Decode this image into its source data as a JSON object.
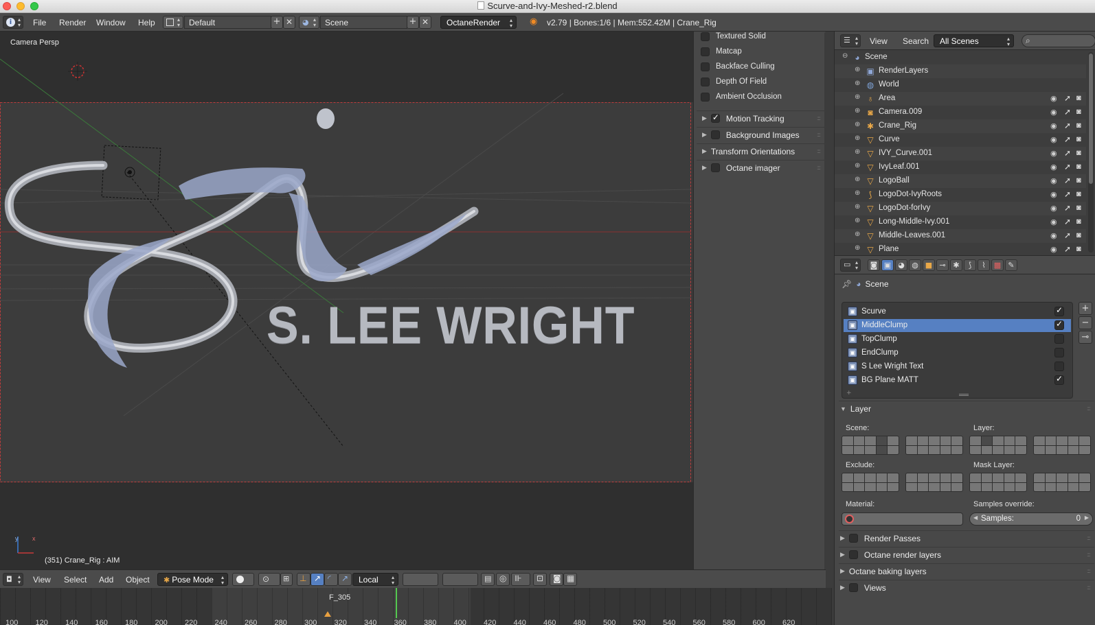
{
  "window": {
    "title": "Scurve-and-Ivy-Meshed-r2.blend"
  },
  "info_header": {
    "menus": [
      "File",
      "Render",
      "Window",
      "Help"
    ],
    "screen_layout": "Default",
    "scene": "Scene",
    "render_engine": "OctaneRender",
    "stats": "v2.79 | Bones:1/6 | Mem:552.42M | Crane_Rig"
  },
  "viewport": {
    "view_label": "Camera Persp",
    "status": "(351) Crane_Rig : AIM",
    "logo_text": "S. LEE WRIGHT",
    "axis_x": "x",
    "axis_y": "y"
  },
  "npanel": {
    "options": [
      {
        "label": "Textured Solid",
        "checked": false
      },
      {
        "label": "Matcap",
        "checked": false
      },
      {
        "label": "Backface Culling",
        "checked": false
      },
      {
        "label": "Depth Of Field",
        "checked": false
      },
      {
        "label": "Ambient Occlusion",
        "checked": false
      }
    ],
    "subpanels": [
      {
        "label": "Motion Tracking",
        "checked": true
      },
      {
        "label": "Background Images",
        "checked": false
      },
      {
        "label": "Transform Orientations",
        "checked": null
      },
      {
        "label": "Octane imager",
        "checked": false
      }
    ]
  },
  "vp_header": {
    "menus": [
      "View",
      "Select",
      "Add",
      "Object"
    ],
    "mode": "Pose Mode",
    "orientation": "Local"
  },
  "timeline": {
    "frame_marker": "F_305",
    "ticks": [
      "100",
      "120",
      "140",
      "160",
      "180",
      "200",
      "220",
      "240",
      "260",
      "280",
      "300",
      "320",
      "340",
      "360",
      "380",
      "400",
      "420",
      "440",
      "460",
      "480",
      "500",
      "520",
      "540",
      "560",
      "580",
      "600",
      "620"
    ]
  },
  "outliner": {
    "menus": [
      "View",
      "Search"
    ],
    "filter": "All Scenes",
    "root": "Scene",
    "items": [
      {
        "name": "RenderLayers",
        "icon": "render-layers-icon",
        "glyph": "▣",
        "color": "#8fa7d6",
        "visible": false
      },
      {
        "name": "World",
        "icon": "world-icon",
        "glyph": "◍",
        "color": "#7fa4d9",
        "visible": false
      },
      {
        "name": "Area",
        "icon": "lamp-icon",
        "glyph": "♁",
        "color": "#e9a848",
        "visible": true
      },
      {
        "name": "Camera.009",
        "icon": "camera-icon",
        "glyph": "◙",
        "color": "#e9a848",
        "visible": true
      },
      {
        "name": "Crane_Rig",
        "icon": "armature-icon",
        "glyph": "✱",
        "color": "#e9a848",
        "visible": true
      },
      {
        "name": "Curve",
        "icon": "curve-icon",
        "glyph": "▽",
        "color": "#e9a848",
        "visible": true
      },
      {
        "name": "IVY_Curve.001",
        "icon": "mesh-icon",
        "glyph": "▽",
        "color": "#e9a848",
        "visible": true
      },
      {
        "name": "IvyLeaf.001",
        "icon": "mesh-icon",
        "glyph": "▽",
        "color": "#e9a848",
        "visible": true
      },
      {
        "name": "LogoBall",
        "icon": "mesh-icon",
        "glyph": "▽",
        "color": "#e9a848",
        "visible": true
      },
      {
        "name": "LogoDot-IvyRoots",
        "icon": "curve-icon",
        "glyph": "⟆",
        "color": "#e9a848",
        "visible": true
      },
      {
        "name": "LogoDot-forIvy",
        "icon": "mesh-icon",
        "glyph": "▽",
        "color": "#e9a848",
        "visible": true
      },
      {
        "name": "Long-Middle-Ivy.001",
        "icon": "mesh-icon",
        "glyph": "▽",
        "color": "#e9a848",
        "visible": true
      },
      {
        "name": "Middle-Leaves.001",
        "icon": "mesh-icon",
        "glyph": "▽",
        "color": "#e9a848",
        "visible": true
      },
      {
        "name": "Plane",
        "icon": "mesh-icon",
        "glyph": "▽",
        "color": "#e9a848",
        "visible": true
      }
    ]
  },
  "properties": {
    "context": "Scene",
    "render_layers": [
      {
        "name": "Scurve",
        "enabled": true,
        "selected": false
      },
      {
        "name": "MiddleClump",
        "enabled": true,
        "selected": true
      },
      {
        "name": "TopClump",
        "enabled": false,
        "selected": false
      },
      {
        "name": "EndClump",
        "enabled": false,
        "selected": false
      },
      {
        "name": "S Lee Wright Text",
        "enabled": false,
        "selected": false
      },
      {
        "name": "BG Plane MATT",
        "enabled": true,
        "selected": false
      }
    ],
    "layer_panel": {
      "title": "Layer",
      "scene_label": "Scene:",
      "layer_label": "Layer:",
      "exclude_label": "Exclude:",
      "mask_label": "Mask Layer:",
      "material_label": "Material:",
      "samples_override_label": "Samples override:",
      "samples_label": "Samples:",
      "samples_value": "0"
    },
    "collapsed_panels": [
      {
        "label": "Render Passes",
        "checkbox": true
      },
      {
        "label": "Octane render layers",
        "checkbox": true
      },
      {
        "label": "Octane baking layers",
        "checkbox": false
      },
      {
        "label": "Views",
        "checkbox": true
      }
    ]
  }
}
